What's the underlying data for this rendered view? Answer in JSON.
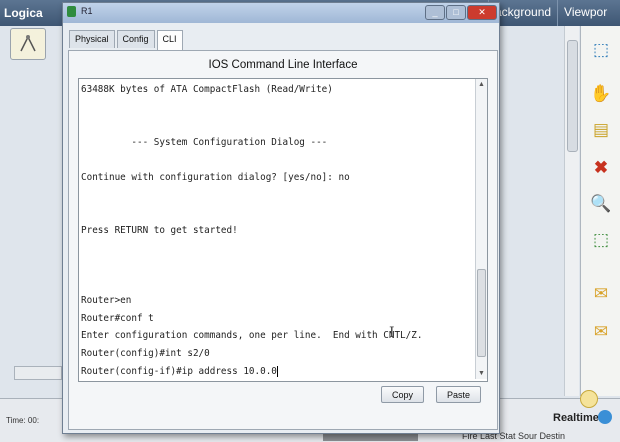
{
  "background": {
    "title_left": "Logica",
    "tabs": [
      "ackground",
      "Viewpor"
    ],
    "time_label": "Time: 00:",
    "realtime_label": "Realtime",
    "status_text": "Fire Last Stat Sour Destin"
  },
  "window": {
    "title": "R1",
    "tabs": [
      "Physical",
      "Config",
      "CLI"
    ],
    "active_tab": "CLI",
    "cli_title": "IOS Command Line Interface",
    "terminal_lines": [
      "63488K bytes of ATA CompactFlash (Read/Write)",
      "",
      "",
      "         --- System Configuration Dialog ---",
      "",
      "Continue with configuration dialog? [yes/no]: no",
      "",
      "",
      "Press RETURN to get started!",
      "",
      "",
      "",
      "Router>en",
      "Router#conf t",
      "Enter configuration commands, one per line.  End with CNTL/Z.",
      "Router(config)#int s2/0",
      "Router(config-if)#ip address 10.0.0"
    ],
    "copy_label": "Copy",
    "paste_label": "Paste"
  },
  "tool_icons": [
    "select-icon",
    "hand-icon",
    "note-icon",
    "delete-icon",
    "zoom-icon",
    "resize-icon",
    "pdu-icon",
    "complex-pdu-icon"
  ]
}
